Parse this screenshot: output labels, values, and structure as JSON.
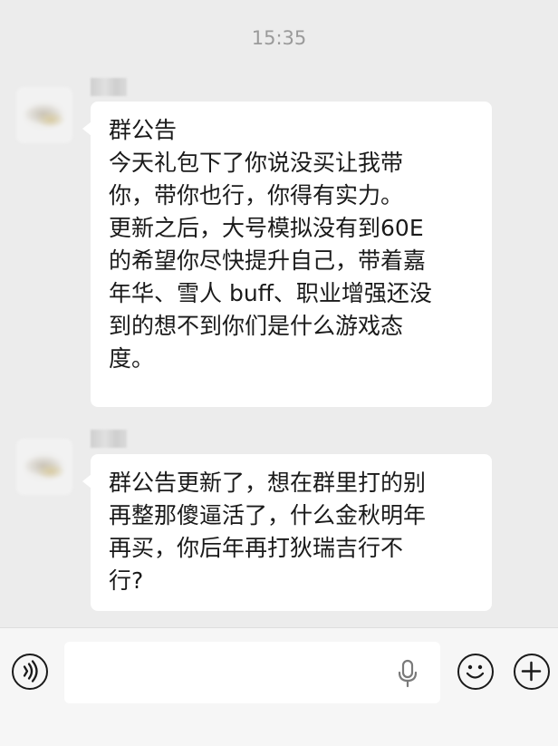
{
  "status": {
    "time": "15:35"
  },
  "messages": [
    {
      "lines": [
        "群公告",
        "今天礼包下了你说没买让我带",
        "你，带你也行，你得有实力。",
        "更新之后，大号模拟没有到60E",
        "的希望你尽快提升自己，带着嘉",
        "年华、雪人 buff、职业增强还没",
        "到的想不到你们是什么游戏态",
        "度。"
      ]
    },
    {
      "lines": [
        "群公告更新了，想在群里打的别",
        "再整那傻逼活了，什么金秋明年",
        "再买，你后年再打狄瑞吉行不",
        "行?"
      ]
    }
  ],
  "input_bar": {
    "voice_icon": "voice-wave-icon",
    "mic_icon": "microphone-icon",
    "emoji_icon": "emoji-icon",
    "plus_icon": "plus-icon",
    "message_value": ""
  }
}
